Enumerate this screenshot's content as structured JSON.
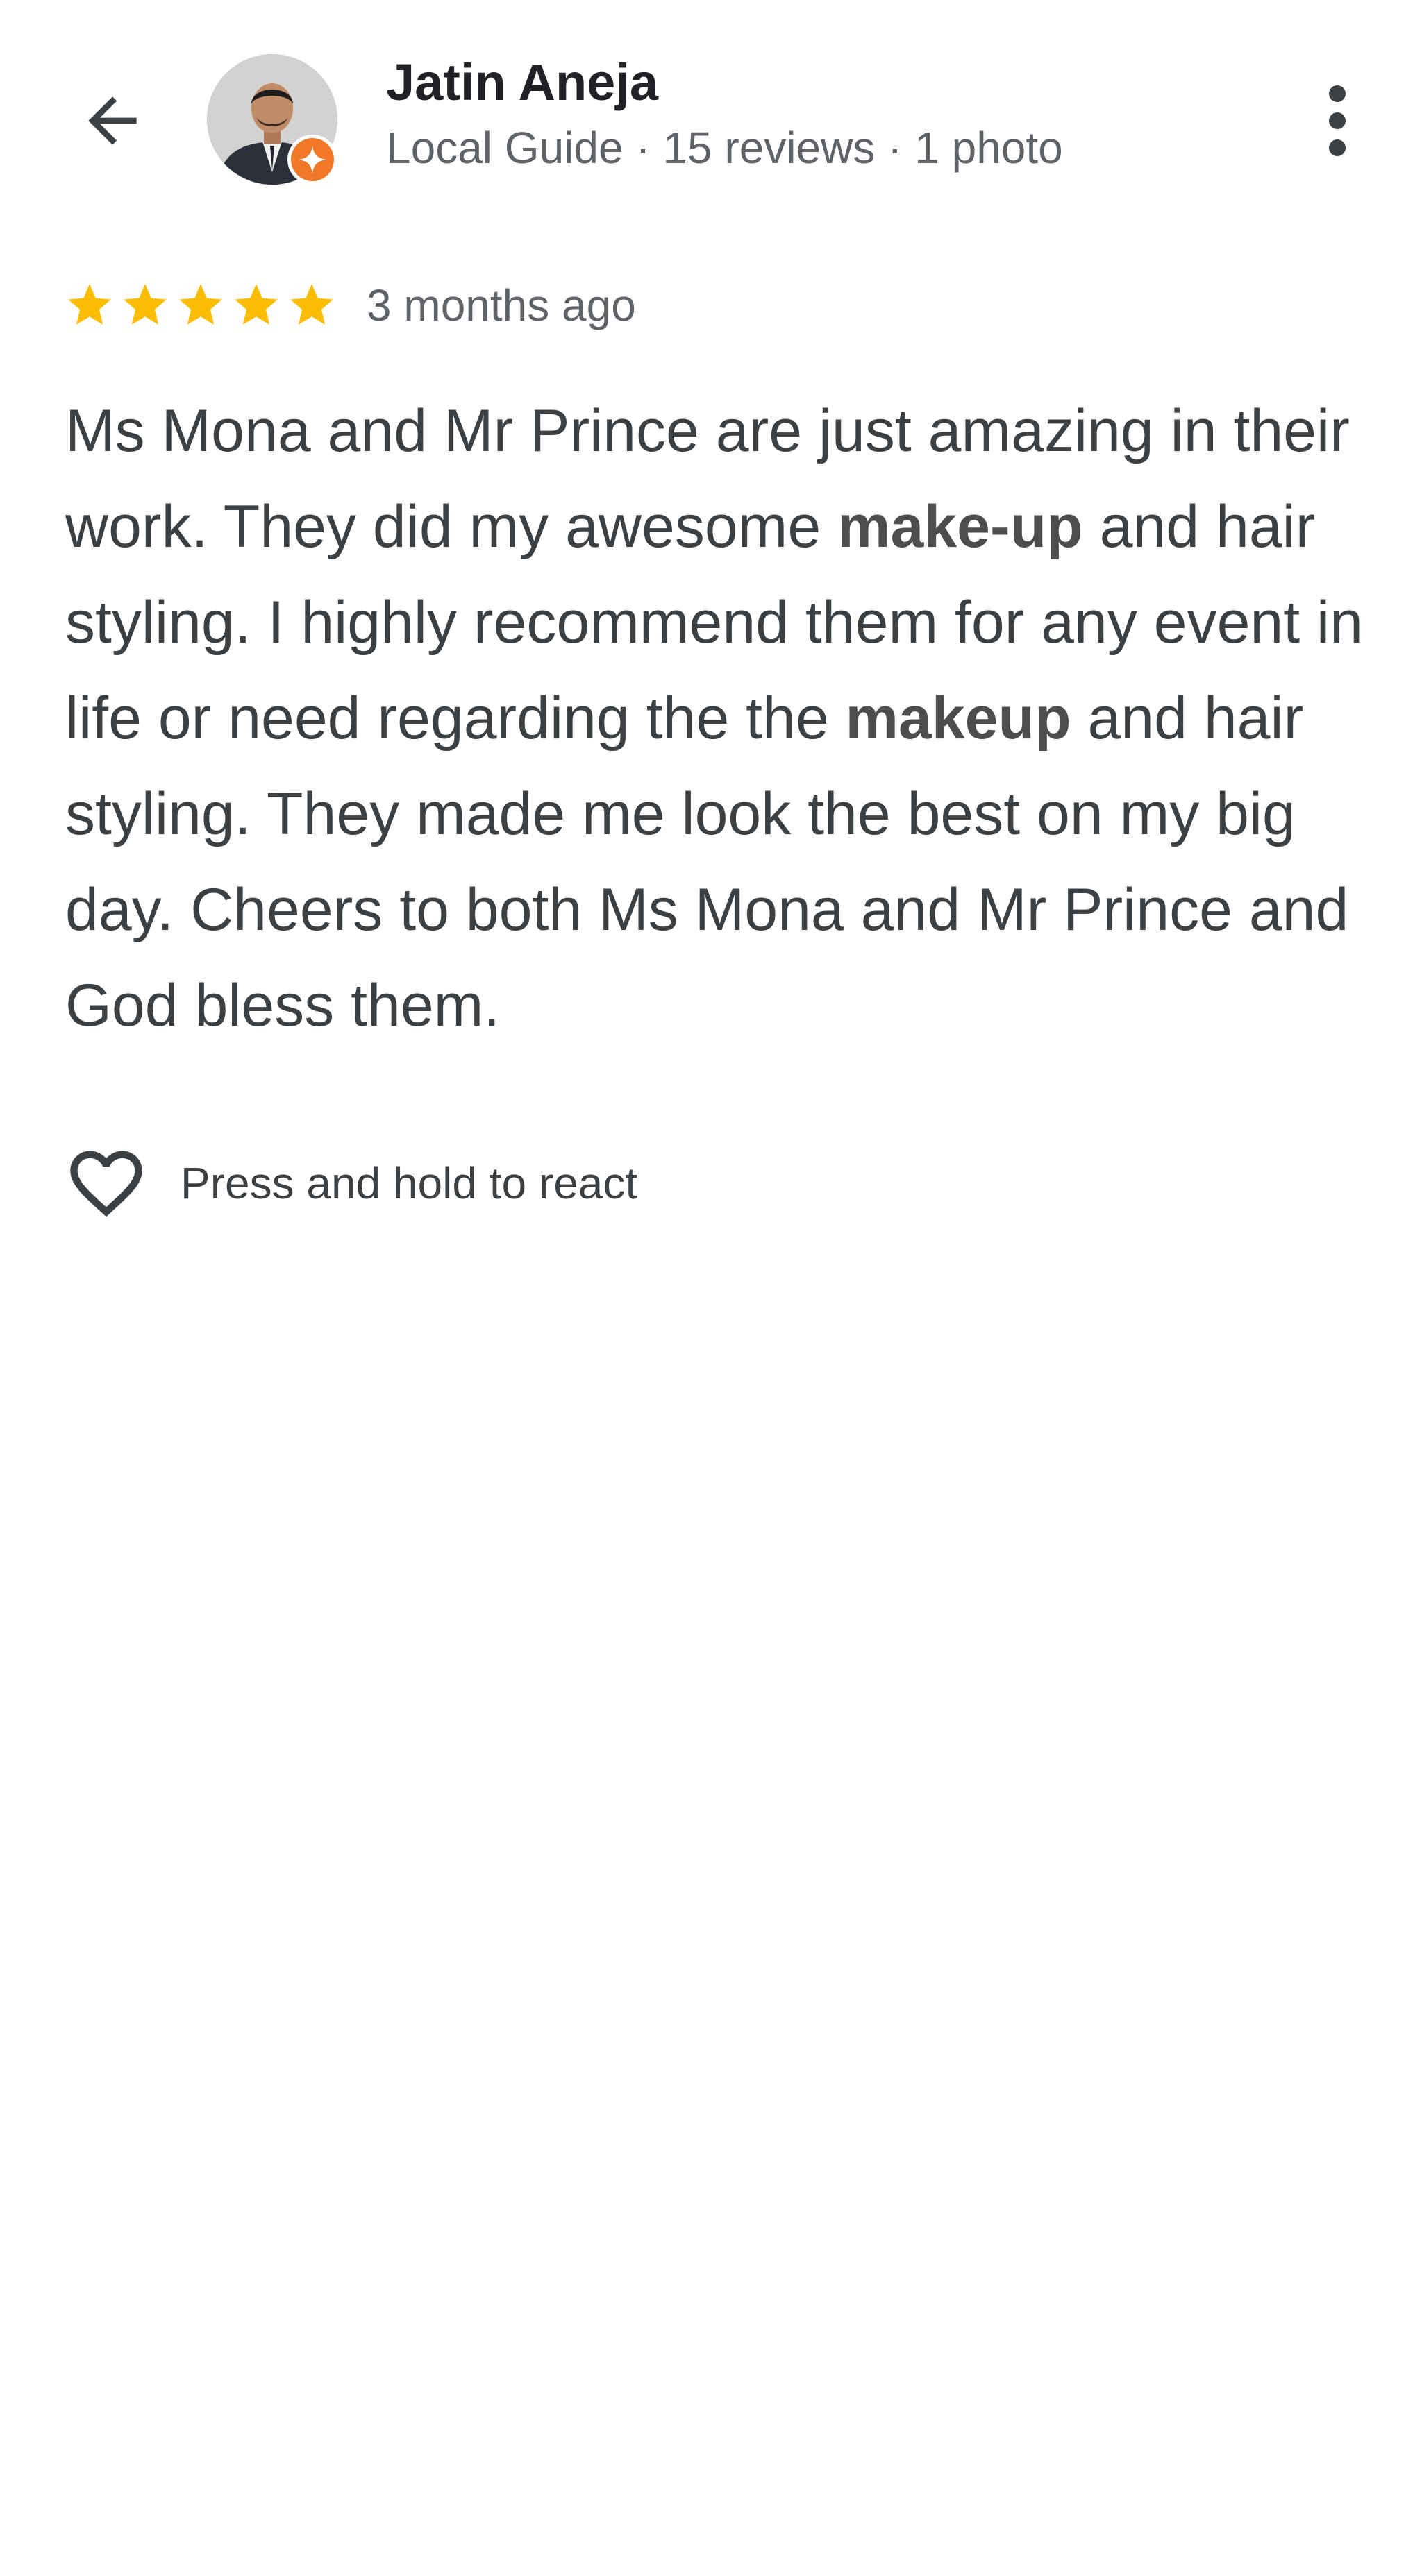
{
  "header": {
    "back_icon": "arrow-back-icon",
    "avatar_icon": "profile-photo",
    "badge_icon": "local-guide-badge-icon",
    "badge_color": "#F07827",
    "user_name": "Jatin Aneja",
    "user_meta": "Local Guide · 15 reviews · 1 photo",
    "more_icon": "more-vert-icon"
  },
  "review": {
    "rating": 5,
    "rating_max": 5,
    "star_color": "#FBBC04",
    "age": "3 months ago",
    "text_parts": [
      {
        "text": "Ms Mona and Mr Prince are just amazing in their work. They did my awesome ",
        "bold": false
      },
      {
        "text": "make-up",
        "bold": true
      },
      {
        "text": " and hair styling. I highly recommend them for any event in life or need regarding the the ",
        "bold": false
      },
      {
        "text": "makeup",
        "bold": true
      },
      {
        "text": " and hair styling. They made me look the best on my big day. Cheers to both Ms Mona and Mr Prince and God bless them.",
        "bold": false
      }
    ]
  },
  "reaction": {
    "heart_icon": "heart-outline-icon",
    "label": "Press and hold to react"
  }
}
